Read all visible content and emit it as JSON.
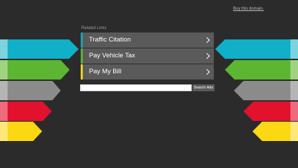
{
  "header": {
    "buy_link": "Buy this domain."
  },
  "related": {
    "label": "Related Links",
    "items": [
      {
        "label": "Traffic Citation",
        "accent": "#1aa4b8"
      },
      {
        "label": "Pay Vehicle Tax",
        "accent": "#5fb336"
      },
      {
        "label": "Pay My Bill",
        "accent": "#f0d21d"
      }
    ]
  },
  "search": {
    "value": "",
    "button_label": "Search Ads"
  },
  "decor": {
    "colors": [
      "#0fb0c8",
      "#5cb631",
      "#8b8b8b",
      "#e2112e",
      "#fbd714"
    ]
  }
}
